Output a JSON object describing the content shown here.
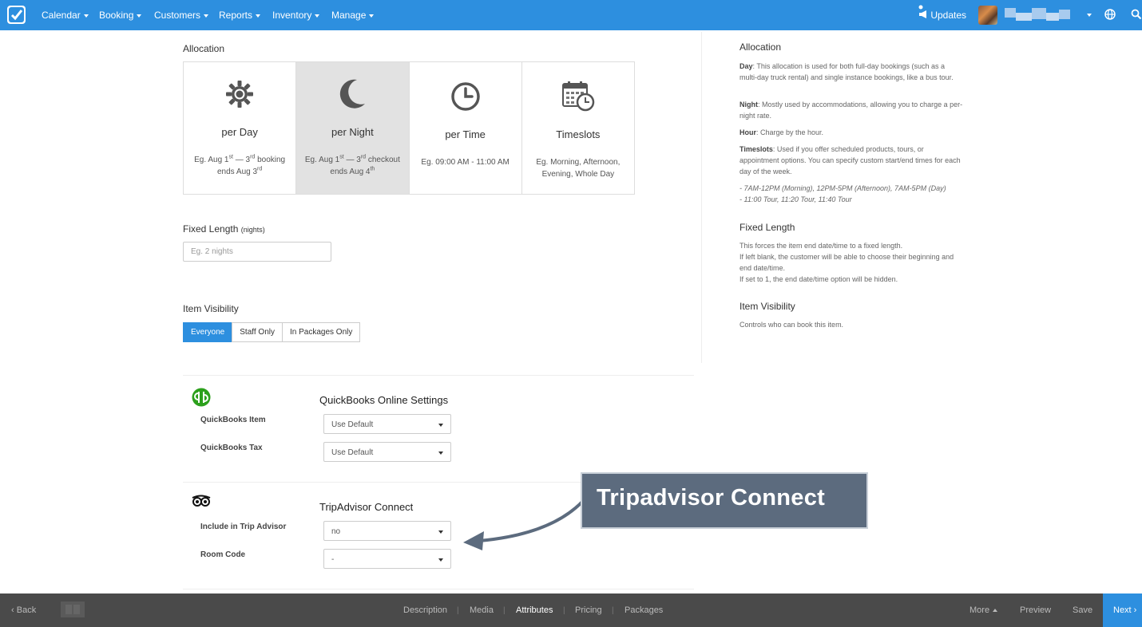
{
  "topnav": {
    "menu": [
      {
        "label": "Calendar"
      },
      {
        "label": "Booking"
      },
      {
        "label": "Customers"
      },
      {
        "label": "Reports"
      },
      {
        "label": "Inventory"
      },
      {
        "label": "Manage"
      }
    ],
    "updates_label": "Updates",
    "colors": {
      "bar": "#2d8fdf"
    }
  },
  "allocation": {
    "title": "Allocation",
    "options": [
      {
        "icon": "sun-icon",
        "label": "per Day"
      },
      {
        "icon": "moon-icon",
        "label": "per Night",
        "selected": true
      },
      {
        "icon": "clock-icon",
        "label": "per Time",
        "desc": "Eg. 09:00 AM - 11:00 AM"
      },
      {
        "icon": "calendar-clock-icon",
        "label": "Timeslots",
        "desc": "Eg. Morning, Afternoon, Evening, Whole Day"
      }
    ],
    "day_desc": {
      "a": "Eg. Aug 1",
      "a_sup": "st",
      "b": " — 3",
      "b_sup": "rd",
      "c": " booking ends Aug 3",
      "c_sup": "rd"
    },
    "night_desc": {
      "a": "Eg. Aug 1",
      "a_sup": "st",
      "b": " — 3",
      "b_sup": "rd",
      "c": " checkout ends Aug 4",
      "c_sup": "th"
    }
  },
  "fixed_length": {
    "title": "Fixed Length",
    "unit": "(nights)",
    "placeholder": "Eg. 2 nights"
  },
  "item_visibility": {
    "title": "Item Visibility",
    "options": [
      "Everyone",
      "Staff Only",
      "In Packages Only"
    ],
    "selected": "Everyone"
  },
  "quickbooks": {
    "title": "QuickBooks Online Settings",
    "item_label": "QuickBooks Item",
    "item_value": "Use Default",
    "tax_label": "QuickBooks Tax",
    "tax_value": "Use Default"
  },
  "tripadvisor": {
    "title": "TripAdvisor Connect",
    "include_label": "Include in Trip Advisor",
    "include_value": "no",
    "room_label": "Room Code",
    "room_value": "-"
  },
  "callout": {
    "text": "Tripadvisor Connect"
  },
  "help": {
    "allocation": {
      "title": "Allocation",
      "day_key": "Day",
      "day_text": ": This allocation is used for both full-day bookings (such as a multi-day truck rental) and single instance bookings, like a bus tour.",
      "night_key": "Night",
      "night_text": ": Mostly used by accommodations, allowing you to charge a per-night rate.",
      "hour_key": "Hour",
      "hour_text": ": Charge by the hour.",
      "timeslots_key": "Timeslots",
      "timeslots_text": ": Used if you offer scheduled products, tours, or appointment options. You can specify custom start/end times for each day of the week.",
      "example_1": "- 7AM-12PM (Morning), 12PM-5PM (Afternoon), 7AM-5PM (Day)",
      "example_2": "- 11:00 Tour, 11:20 Tour, 11:40 Tour"
    },
    "fixed_length": {
      "title": "Fixed Length",
      "line1": "This forces the item end date/time to a fixed length.",
      "line2": "If left blank, the customer will be able to choose their beginning and end date/time.",
      "line3": "If set to 1, the end date/time option will be hidden."
    },
    "item_visibility": {
      "title": "Item Visibility",
      "text": "Controls who can book this item."
    }
  },
  "bottombar": {
    "back": "Back",
    "tabs": [
      "Description",
      "Media",
      "Attributes",
      "Pricing",
      "Packages"
    ],
    "active_tab": "Attributes",
    "more": "More",
    "preview": "Preview",
    "save": "Save",
    "next": "Next"
  }
}
